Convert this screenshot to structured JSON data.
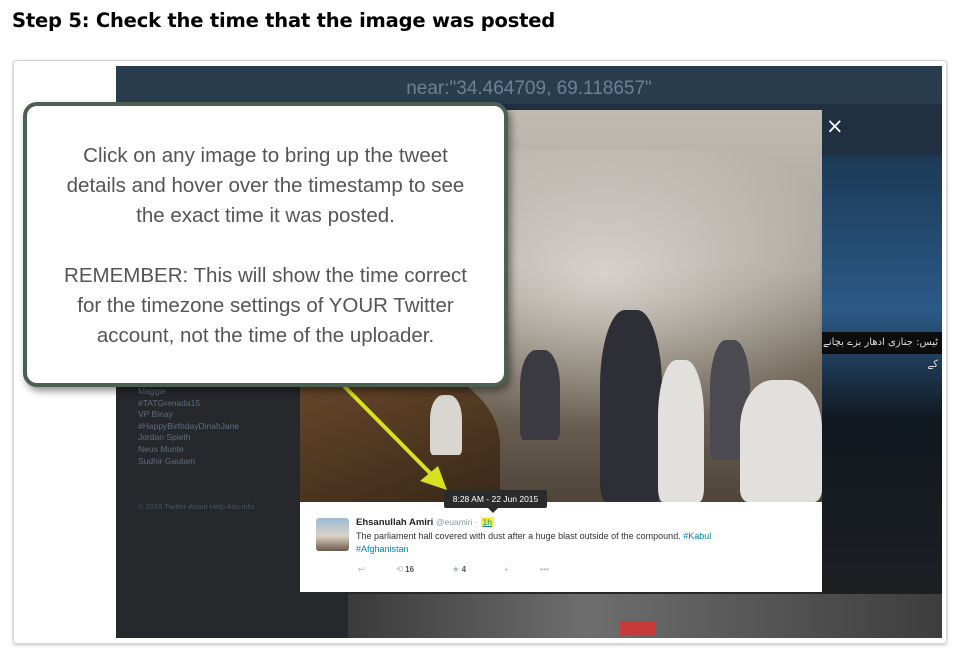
{
  "page": {
    "step_title": "Step 5: Check the time that the image was posted"
  },
  "screen": {
    "search_query": "near:\"34.464709, 69.118657\"",
    "trends": [
      "Maggie",
      "#TATGrenada15",
      "VP Binay",
      "#HappyBirthdayDinahJane",
      "Jordan Spieth",
      "Neus Munte",
      "Sudhir Gautam"
    ],
    "footer": "© 2015 Twitter   About   Help   Ads info",
    "urdu_caption": "ٹیس: جنازی ادھار بزے بچانے کے"
  },
  "modal": {
    "close_label": "×",
    "tooltip": "8:28 AM - 22 Jun 2015",
    "tweet": {
      "name": "Ehsanullah Amiri",
      "handle": "@euamiri",
      "separator": "·",
      "time": "1h",
      "text": "The parliament hall covered with dust after a huge blast outside of the compound.",
      "hashtag_1": "#Kabul",
      "hashtag_2": "#Afghanistan",
      "actions": {
        "reply_icon": "↩",
        "retweet_icon": "⟲",
        "retweet_count": "16",
        "favorite_icon": "★",
        "favorite_count": "4",
        "follow_icon": "+",
        "more_icon": "•••"
      }
    }
  },
  "callout": {
    "line1": "Click on any image to bring up the tweet",
    "line2": "details and hover over the timestamp to see",
    "line3": "the exact time it was posted.",
    "line4": "REMEMBER: This will show the time correct",
    "line5": "for the timezone settings of YOUR Twitter",
    "line6": "account, not the time of the uploader."
  },
  "colors": {
    "highlight": "#f8f43a",
    "arrow": "#d8e020",
    "callout_border": "#4b5f52",
    "twitter_link": "#0084b4"
  }
}
